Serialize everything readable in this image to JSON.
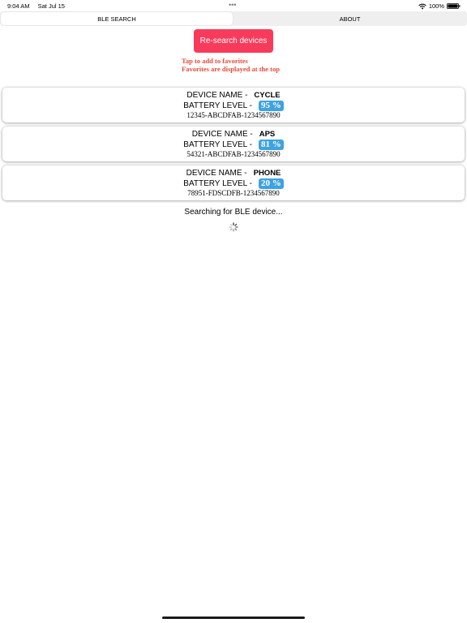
{
  "status_bar": {
    "time": "9:04 AM",
    "date": "Sat Jul 15",
    "battery_percent": "100%"
  },
  "tabs": [
    {
      "label": "BLE SEARCH",
      "selected": true
    },
    {
      "label": "ABOUT",
      "selected": false
    }
  ],
  "research_button": {
    "label": "Re-search devices",
    "color": "#f83b5b"
  },
  "hints": [
    "Tap to add to favorites",
    "Favorites are displayed at the top"
  ],
  "labels": {
    "device_name": "DEVICE NAME -",
    "battery_level": "BATTERY LEVEL -"
  },
  "devices": [
    {
      "name": "CYCLE",
      "battery": "95 %",
      "id": "12345-ABCDFAB-1234567890"
    },
    {
      "name": "APS",
      "battery": "81 %",
      "id": "54321-ABCDFAB-1234567890"
    },
    {
      "name": "PHONE",
      "battery": "20 %",
      "id": "78951-FDSCDFB-1234567890"
    }
  ],
  "searching_text": "Searching for BLE device...",
  "colors": {
    "accent": "#f83b5b",
    "hint": "#e84a3a",
    "battery_badge": "#3ea3df"
  },
  "icons": {
    "wifi": "wifi-icon",
    "battery": "battery-icon",
    "spinner": "loading-spinner-icon",
    "multitasking": "multitasking-dots-icon"
  }
}
